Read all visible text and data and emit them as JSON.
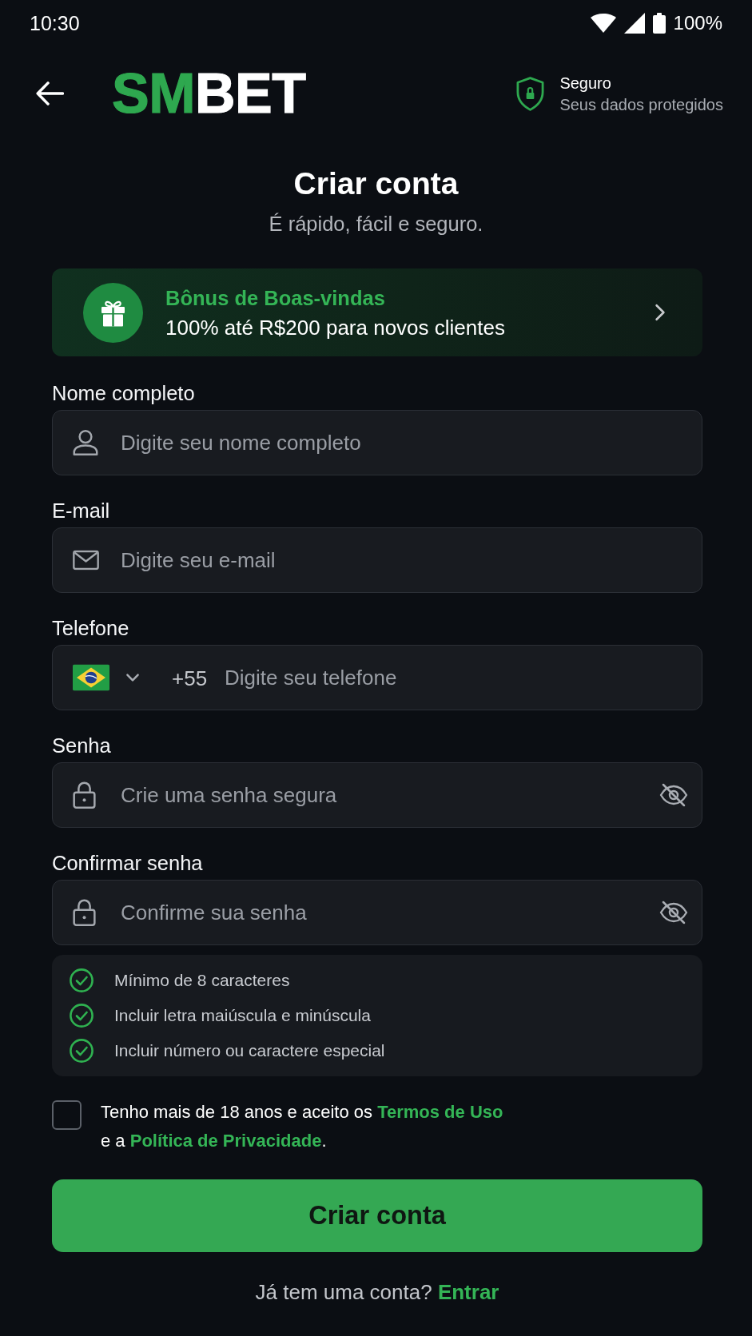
{
  "status_bar": {
    "time": "10:30",
    "battery": "100%"
  },
  "header": {
    "logo": {
      "accent": "SM",
      "rest": "BET"
    },
    "security": {
      "title": "Seguro",
      "subtitle": "Seus dados protegidos"
    }
  },
  "heading": {
    "title": "Criar conta",
    "subtitle": "É rápido, fácil e seguro."
  },
  "bonus": {
    "title": "Bônus de Boas-vindas",
    "description": "100% até R$200 para novos clientes"
  },
  "fields": [
    {
      "kind": "text",
      "label": "Nome completo",
      "placeholder": "Digite seu nome completo"
    },
    {
      "kind": "email",
      "label": "E-mail",
      "placeholder": "Digite seu e-mail"
    },
    {
      "kind": "phone",
      "label": "Telefone",
      "prefix": "+55",
      "placeholder": "Digite seu telefone"
    },
    {
      "kind": "password",
      "label": "Senha",
      "placeholder": "Crie uma senha segura"
    },
    {
      "kind": "password",
      "label": "Confirmar senha",
      "placeholder": "Confirme sua senha"
    }
  ],
  "requirements": [
    {
      "text": "Mínimo de 8 caracteres",
      "met": true
    },
    {
      "text": "Incluir letra maiúscula e minúscula",
      "met": true
    },
    {
      "text": "Incluir número ou caractere especial",
      "met": true
    }
  ],
  "terms": {
    "checked": false,
    "text": "Tenho mais de 18 anos e aceito os",
    "terms_link": "Termos de Uso",
    "joiner": "e a",
    "privacy_link": "Política de Privacidade",
    "end": "."
  },
  "submit": {
    "label": "Criar conta"
  },
  "login_prompt": {
    "text": "Já tem uma conta?",
    "link": "Entrar"
  }
}
